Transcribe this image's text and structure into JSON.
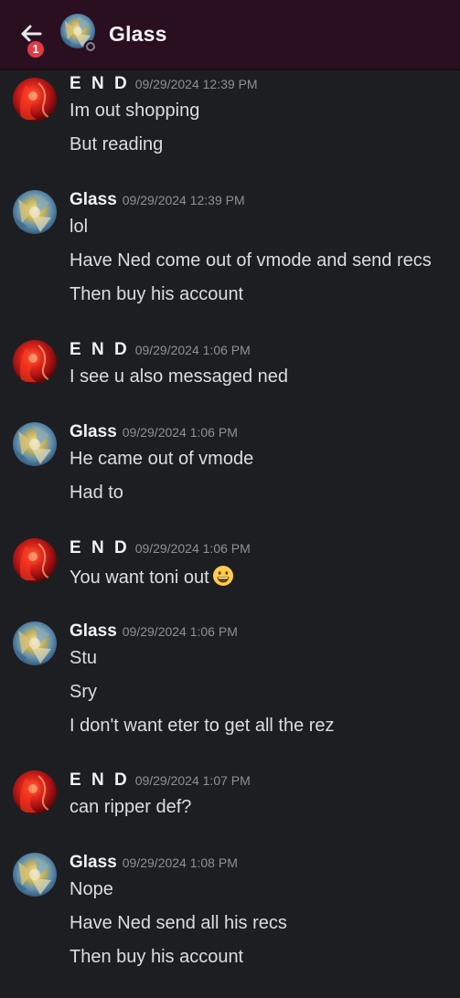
{
  "header": {
    "title": "Glass",
    "unread_count": "1",
    "back_icon": "arrow-left-icon",
    "status_icon": "offline-status-icon"
  },
  "colors": {
    "background": "#1d1e22",
    "header": "#2a0f20",
    "badge": "#e03c45",
    "username": "#f2f3f5",
    "timestamp": "#8e9097",
    "text": "#dcdde1"
  },
  "messages": [
    {
      "author": "E N D",
      "timestamp": "09/29/2024 12:39 PM",
      "lines": [
        "Im out shopping",
        "But reading"
      ]
    },
    {
      "author": "Glass",
      "timestamp": "09/29/2024 12:39 PM",
      "lines": [
        "lol",
        "Have Ned come out of vmode and send recs",
        "Then buy his account"
      ]
    },
    {
      "author": "E N D",
      "timestamp": "09/29/2024 1:06 PM",
      "lines": [
        "I see u also messaged ned"
      ]
    },
    {
      "author": "Glass",
      "timestamp": "09/29/2024 1:06 PM",
      "lines": [
        "He came out of vmode",
        "Had to"
      ]
    },
    {
      "author": "E N D",
      "timestamp": "09/29/2024 1:06 PM",
      "lines": [
        "You want toni out"
      ],
      "emoji": "grinning-face-emoji"
    },
    {
      "author": "Glass",
      "timestamp": "09/29/2024 1:06 PM",
      "lines": [
        "Stu",
        "Sry",
        "I don't want eter to get all the rez"
      ]
    },
    {
      "author": "E N D",
      "timestamp": "09/29/2024 1:07 PM",
      "lines": [
        "can ripper def?"
      ]
    },
    {
      "author": "Glass",
      "timestamp": "09/29/2024 1:08 PM",
      "lines": [
        "Nope",
        "Have Ned send all his recs",
        "Then buy his account"
      ]
    }
  ]
}
